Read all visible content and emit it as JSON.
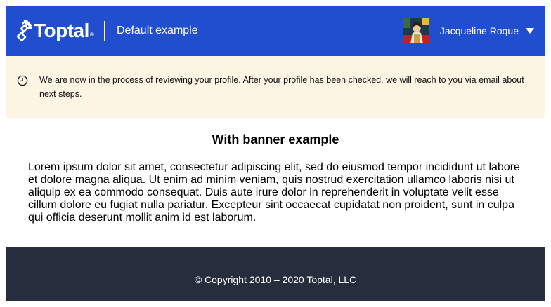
{
  "header": {
    "logo_text": "Toptal",
    "logo_reg": "®",
    "title": "Default example",
    "user_name": "Jacqueline Roque",
    "avatar_icon": "user-avatar-image",
    "dropdown_icon": "caret-down-icon",
    "background_color": "#204ecf"
  },
  "banner": {
    "icon": "clock-icon",
    "text": "We are now in the process of reviewing your profile. After your profile has been checked, we will reach to you via email about next steps.",
    "background_color": "#fdf5e3"
  },
  "main": {
    "title": "With banner example",
    "body": "Lorem ipsum dolor sit amet, consectetur adipiscing elit, sed do eiusmod tempor incididunt ut labore et dolore magna aliqua. Ut enim ad minim veniam, quis nostrud exercitation ullamco laboris nisi ut aliquip ex ea commodo consequat. Duis aute irure dolor in reprehenderit in voluptate velit esse cillum dolore eu fugiat nulla pariatur. Excepteur sint occaecat cupidatat non proident, sunt in culpa qui officia deserunt mollit anim id est laborum."
  },
  "footer": {
    "copyright": "© Copyright 2010 – 2020 Toptal, LLC",
    "background_color": "#262d3d"
  }
}
